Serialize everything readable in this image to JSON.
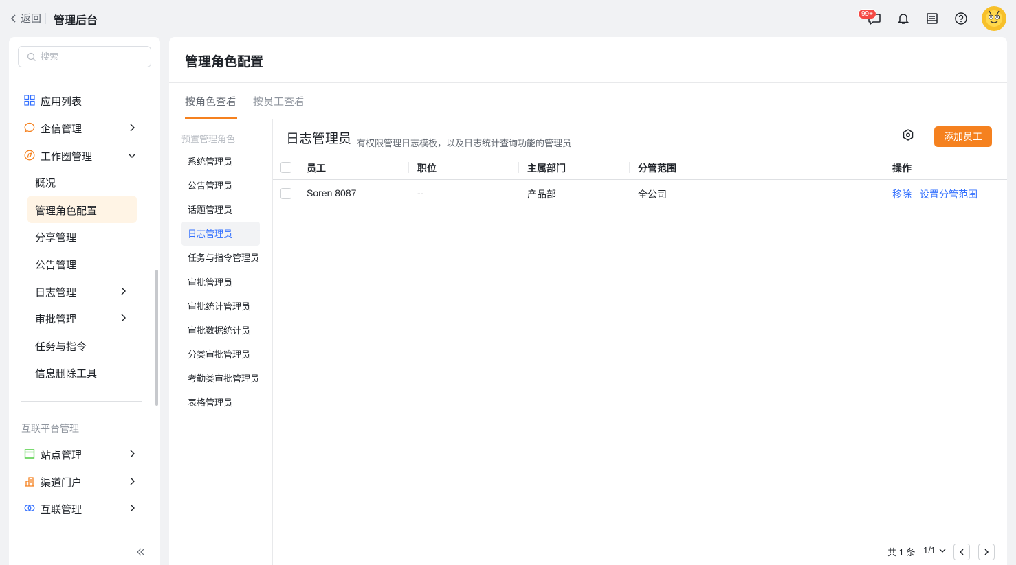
{
  "topbar": {
    "back_label": "返回",
    "title": "管理后台",
    "message_badge": "99+"
  },
  "sidebar": {
    "search_placeholder": "搜索",
    "items": [
      {
        "label": "应用列表",
        "icon": "grid-icon"
      },
      {
        "label": "企信管理",
        "icon": "chat-bubble-icon"
      },
      {
        "label": "工作圈管理",
        "icon": "compass-icon"
      },
      {
        "label": "概况"
      },
      {
        "label": "管理角色配置"
      },
      {
        "label": "分享管理"
      },
      {
        "label": "公告管理"
      },
      {
        "label": "日志管理"
      },
      {
        "label": "审批管理"
      },
      {
        "label": "任务与指令"
      },
      {
        "label": "信息删除工具"
      }
    ],
    "section_label": "互联平台管理",
    "section_items": [
      {
        "label": "站点管理",
        "icon": "site-icon"
      },
      {
        "label": "渠道门户",
        "icon": "building-icon"
      },
      {
        "label": "互联管理",
        "icon": "link-rings-icon"
      }
    ]
  },
  "main": {
    "title": "管理角色配置",
    "tabs": [
      {
        "label": "按角色查看",
        "active": true
      },
      {
        "label": "按员工查看",
        "active": false
      }
    ],
    "role_group": "预置管理角色",
    "roles": [
      "系统管理员",
      "公告管理员",
      "话题管理员",
      "日志管理员",
      "任务与指令管理员",
      "审批管理员",
      "审批统计管理员",
      "审批数据统计员",
      "分类审批管理员",
      "考勤类审批管理员",
      "表格管理员"
    ],
    "selected_role": "日志管理员",
    "role_name": "日志管理员",
    "role_desc": "有权限管理日志模板，以及日志统计查询功能的管理员",
    "add_button": "添加员工",
    "columns": [
      "员工",
      "职位",
      "主属部门",
      "分管范围",
      "操作"
    ],
    "rows": [
      {
        "employee": "Soren 8087",
        "position": "--",
        "department": "产品部",
        "scope": "全公司",
        "actions": [
          "移除",
          "设置分管范围"
        ]
      }
    ],
    "pager": {
      "total": "共 1 条",
      "page": "1/1"
    }
  },
  "colors": {
    "accent": "#f5811f",
    "link": "#3370ff",
    "badge": "#f54a45",
    "active_bg": "#fff4e5"
  }
}
